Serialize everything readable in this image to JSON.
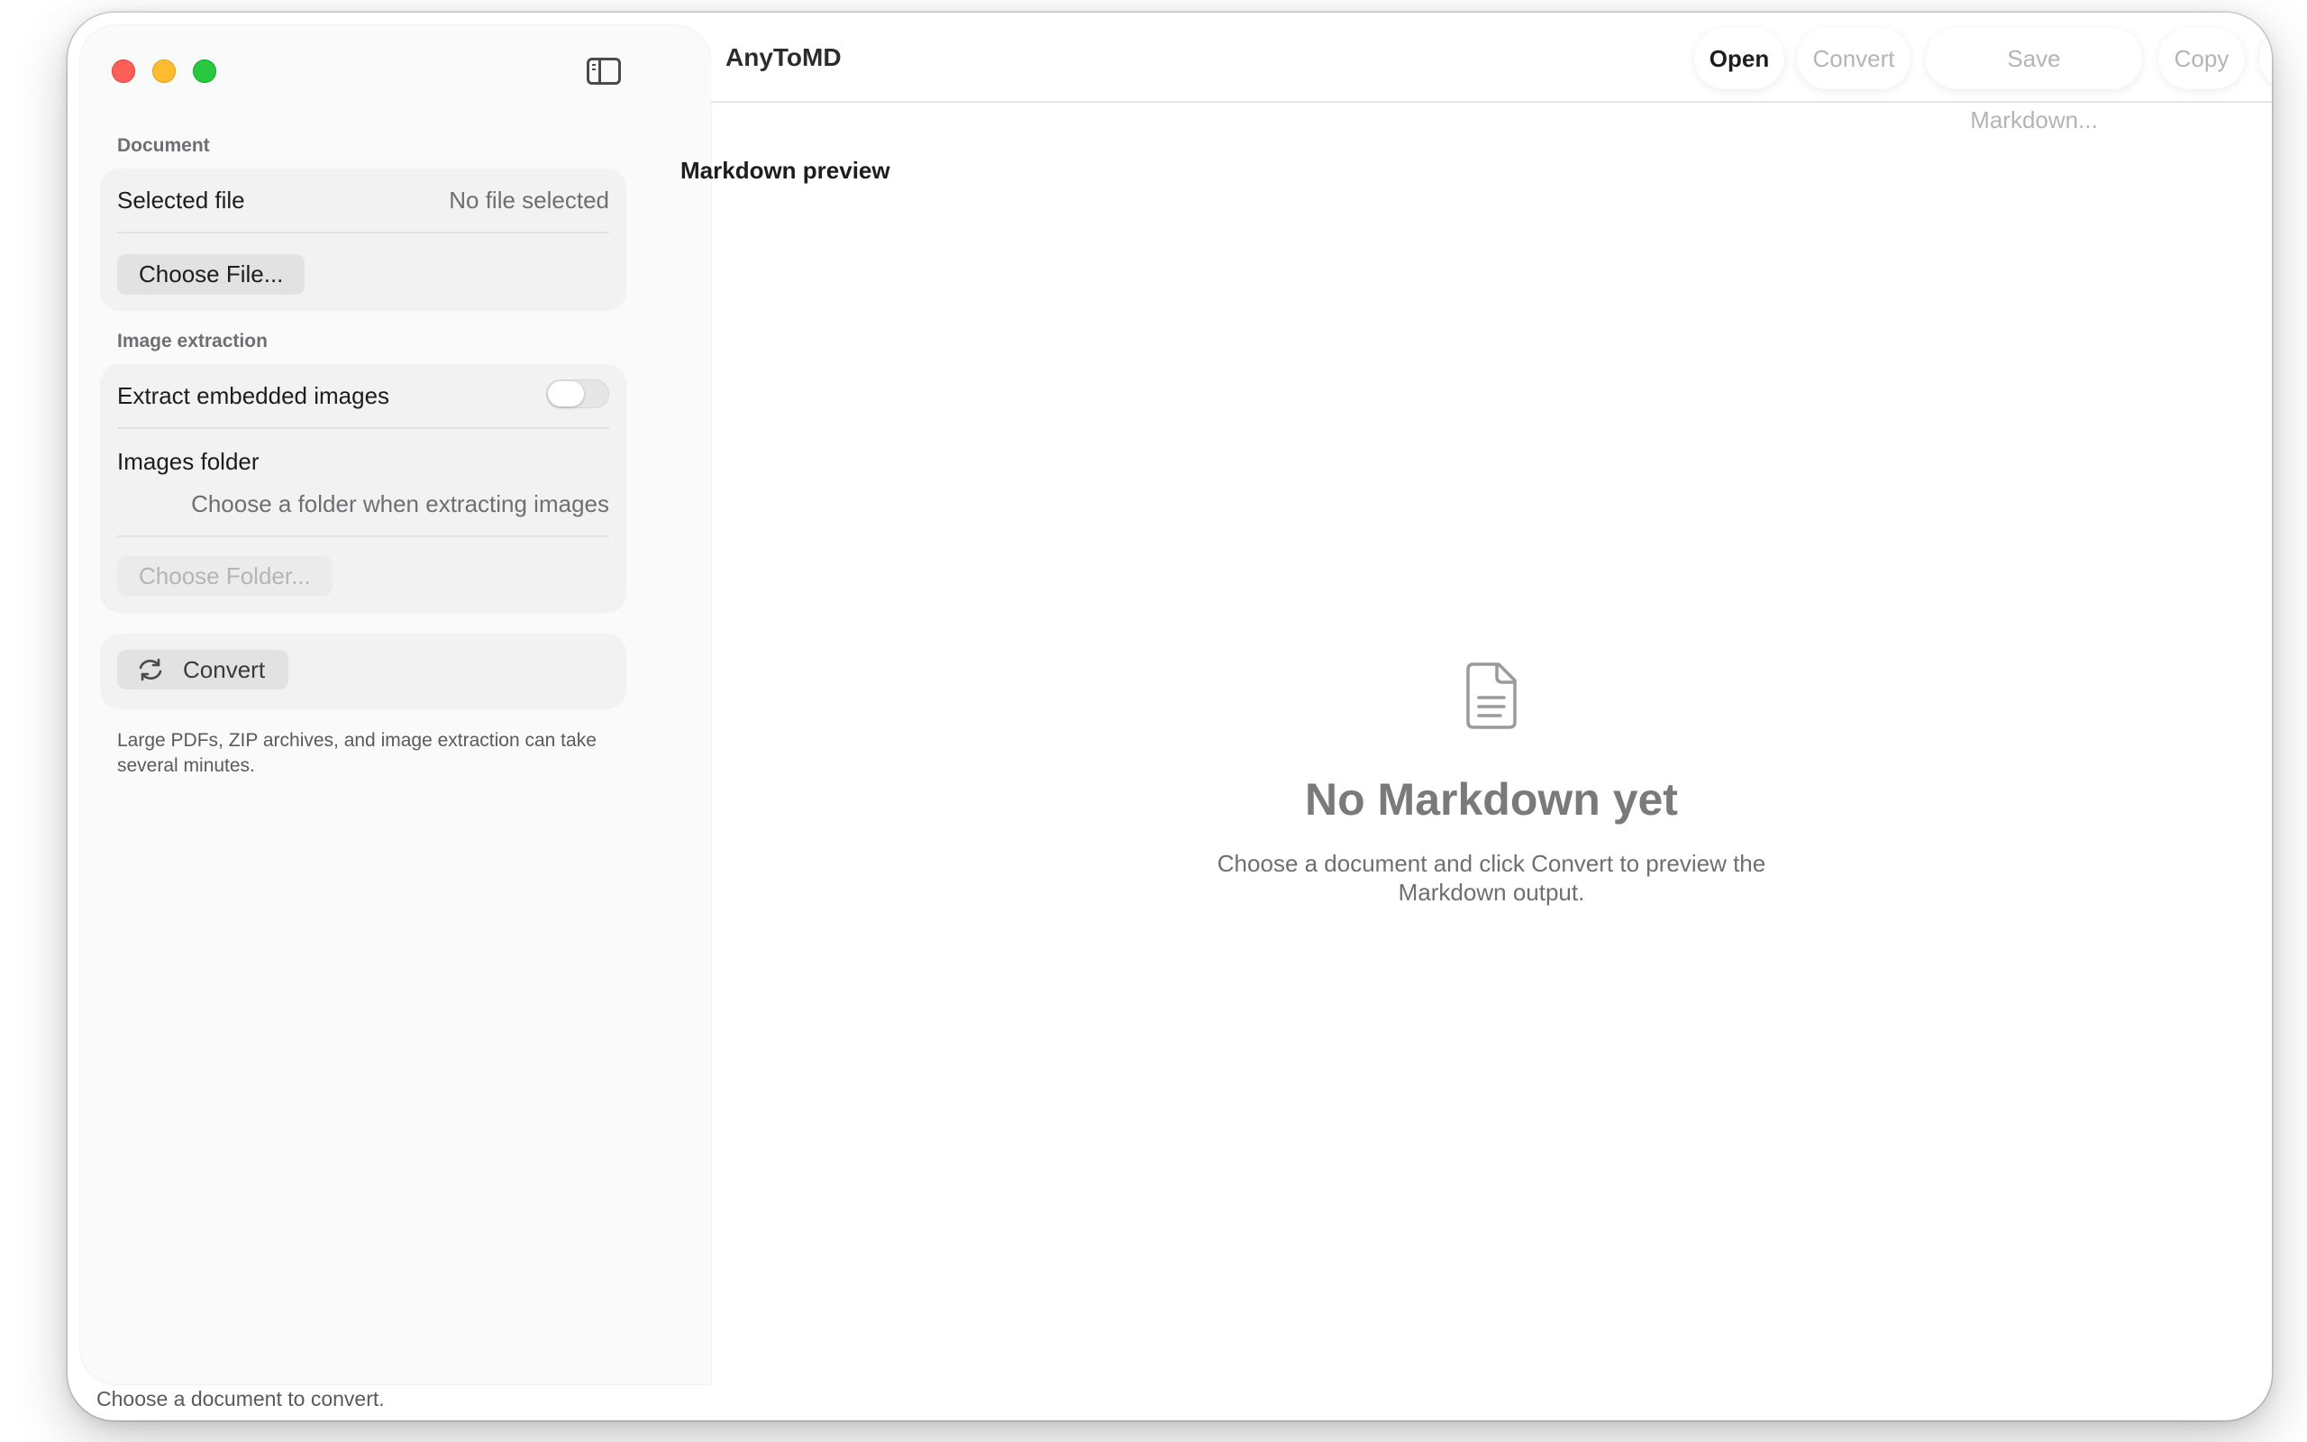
{
  "window": {
    "app_title": "AnyToMD"
  },
  "toolbar": {
    "open_label": "Open",
    "convert_label": "Convert",
    "save_label": "Save Markdown...",
    "copy_label": "Copy",
    "help_symbol": "?"
  },
  "sidebar": {
    "document": {
      "section_label": "Document",
      "selected_file_label": "Selected file",
      "selected_file_value": "No file selected",
      "choose_file_label": "Choose File..."
    },
    "image_extraction": {
      "section_label": "Image extraction",
      "extract_label": "Extract embedded images",
      "extract_enabled": false,
      "images_folder_label": "Images folder",
      "images_folder_value": "Choose a folder when extracting images",
      "choose_folder_label": "Choose Folder..."
    },
    "convert_button_label": "Convert",
    "note": "Large PDFs, ZIP archives, and image extraction can take several minutes."
  },
  "main": {
    "preview_title": "Markdown preview",
    "empty_title": "No Markdown yet",
    "empty_subtitle": "Choose a document and click Convert to preview the Markdown output."
  },
  "status": {
    "text": "Choose a document to convert."
  },
  "colors": {
    "close": "#ff5f57",
    "minimize": "#febc2e",
    "maximize": "#28c840",
    "sidebar_bg": "#fafafa",
    "group_bg": "#f2f2f2"
  }
}
